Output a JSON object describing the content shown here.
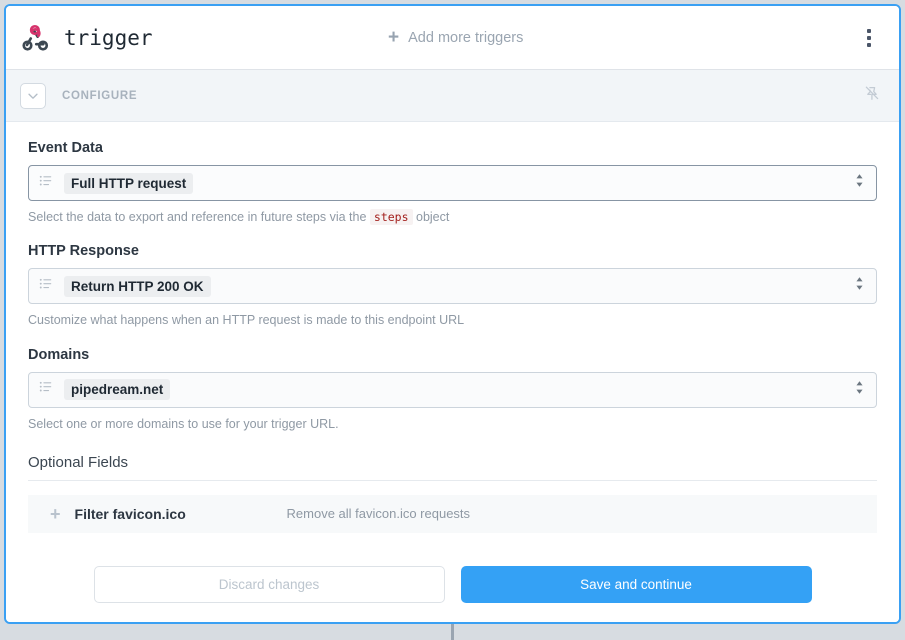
{
  "header": {
    "icon": "webhook-icon",
    "title": "trigger",
    "add_triggers_label": "Add more triggers",
    "add_icon": "plus-icon",
    "menu_icon": "kebab-menu-icon"
  },
  "configure_bar": {
    "collapse_icon": "chevron-down-icon",
    "label": "CONFIGURE",
    "pin_icon": "pin-off-icon"
  },
  "fields": [
    {
      "label": "Event Data",
      "icon": "list-icon",
      "value": "Full HTTP request",
      "help_prefix": "Select the data to export and reference in future steps via the ",
      "help_code": "steps",
      "help_suffix": " object",
      "focused": true
    },
    {
      "label": "HTTP Response",
      "icon": "list-icon",
      "value": "Return HTTP 200 OK",
      "help_prefix": "Customize what happens when an HTTP request is made to this endpoint URL",
      "help_code": "",
      "help_suffix": "",
      "focused": false
    },
    {
      "label": "Domains",
      "icon": "list-icon",
      "value": "pipedream.net",
      "help_prefix": "Select one or more domains to use for your trigger URL.",
      "help_code": "",
      "help_suffix": "",
      "focused": false
    }
  ],
  "optional": {
    "title": "Optional Fields",
    "rows": [
      {
        "add_icon": "plus-icon",
        "name": "Filter favicon.ico",
        "description": "Remove all favicon.ico requests"
      }
    ]
  },
  "footer": {
    "discard_label": "Discard changes",
    "save_label": "Save and continue"
  },
  "colors": {
    "accent": "#34a1f5",
    "card_border": "#3aa0f3",
    "page_bg": "#d7dce1",
    "configure_bg": "#f2f5f8",
    "code_red": "#a3201d",
    "webhook_pink": "#d6336c"
  }
}
